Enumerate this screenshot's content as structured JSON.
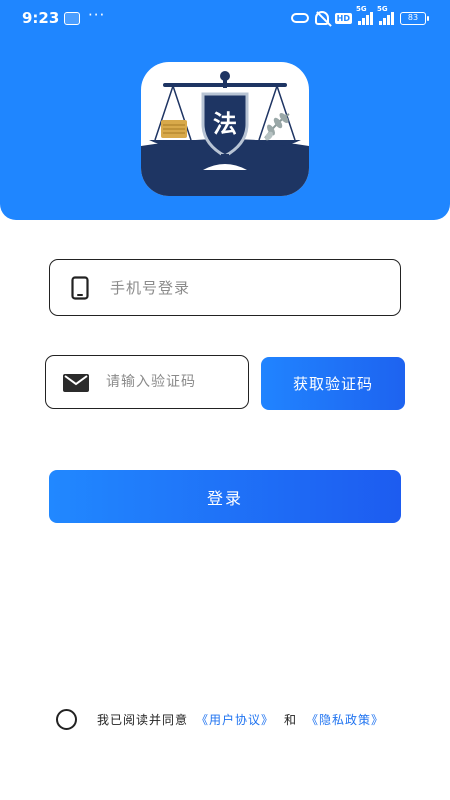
{
  "status_bar": {
    "time": "9:23",
    "more": "···",
    "hd_badge": "HD",
    "network_1": "5G",
    "network_2": "5G",
    "battery": "83",
    "icons": [
      "app-notification-icon",
      "link-icon",
      "mute-icon",
      "signal-icon",
      "battery-icon"
    ]
  },
  "header": {
    "background_color": "#1f86ff",
    "logo": {
      "icon": "scales-of-justice-icon",
      "glyph": "法"
    }
  },
  "form": {
    "phone": {
      "icon": "phone-icon",
      "placeholder": "手机号登录",
      "value": ""
    },
    "code": {
      "icon": "mail-icon",
      "placeholder": "请输入验证码",
      "value": ""
    },
    "get_code_label": "获取验证码",
    "login_label": "登录"
  },
  "agreement": {
    "checked": false,
    "prefix": "我已阅读并同意",
    "user_agreement": "《用户协议》",
    "and": "和",
    "privacy_policy": "《隐私政策》"
  },
  "colors": {
    "accent": "#1f86ff",
    "button_gradient_end": "#1d5cf0",
    "link": "#1f73f0",
    "logo_navy": "#1e3563"
  }
}
